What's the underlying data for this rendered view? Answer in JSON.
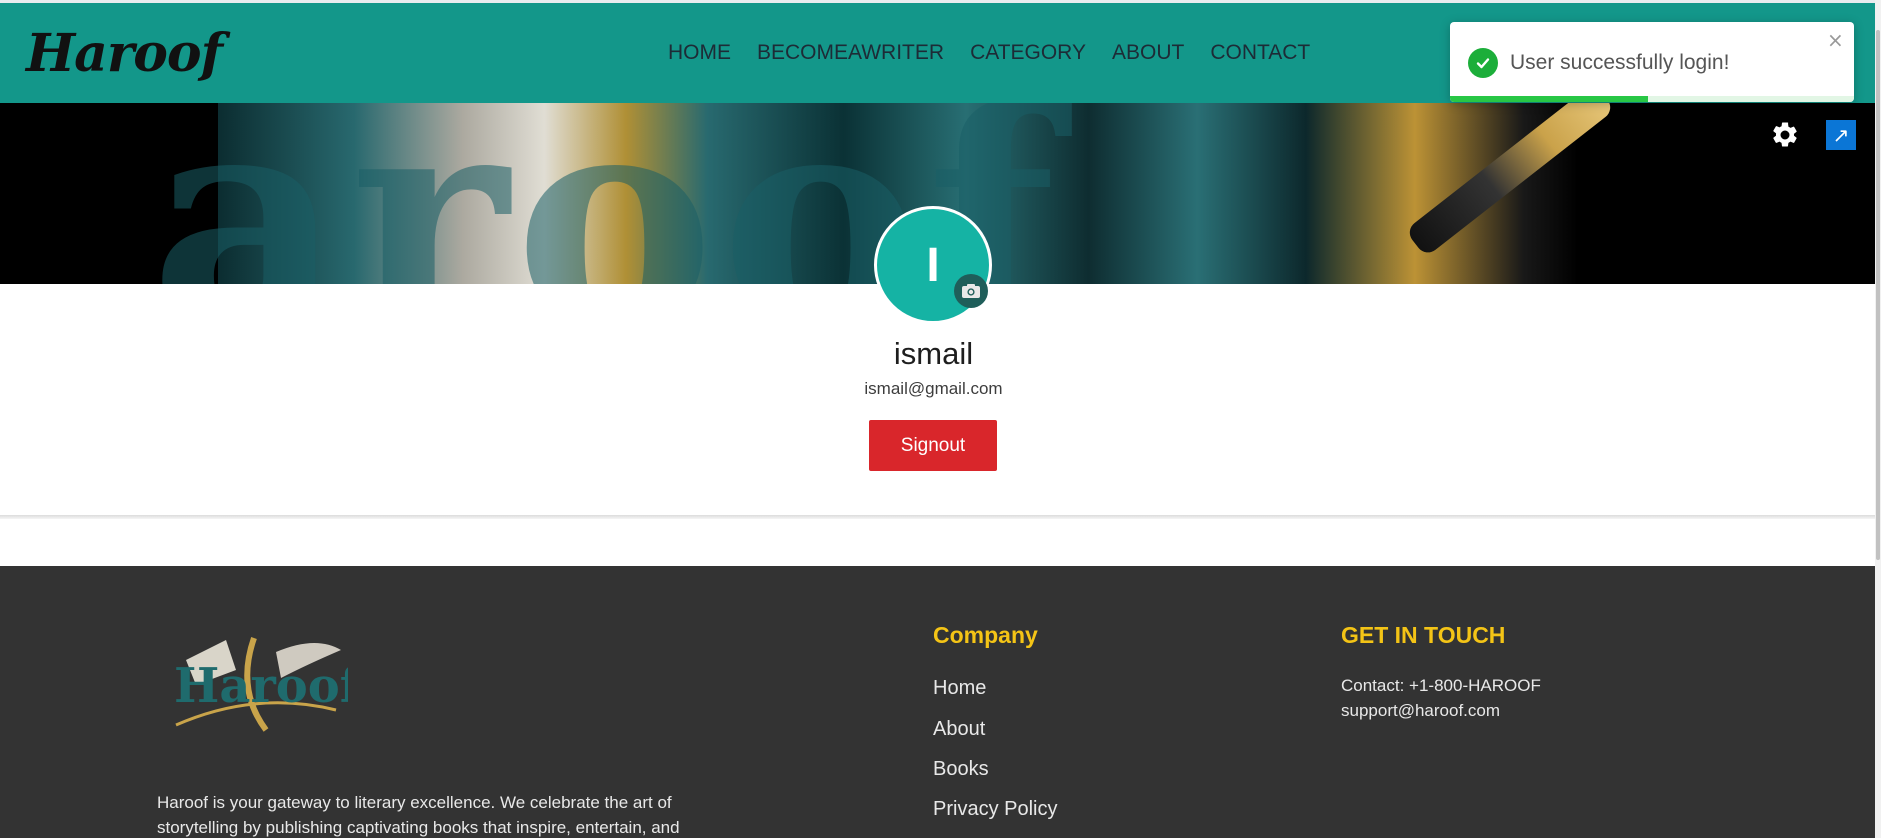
{
  "navbar": {
    "logo": "Haroof",
    "links": [
      "HOME",
      "BECOMEAWRITER",
      "CATEGORY",
      "ABOUT",
      "CONTACT"
    ],
    "background": "#13978a"
  },
  "hero": {
    "expand_glyph": "↗"
  },
  "profile": {
    "initial": "I",
    "name": "ismail",
    "email": "ismail@gmail.com",
    "signout_label": "Signout",
    "signout_color": "#d9262b"
  },
  "toast": {
    "message": "User successfully login!",
    "close_glyph": "×",
    "progress": 0.49
  },
  "footer": {
    "logo_text": "Haroof",
    "about": "Haroof is your gateway to literary excellence. We celebrate the art of storytelling by publishing captivating books that inspire, entertain, and",
    "company_heading": "Company",
    "company_links": [
      "Home",
      "About",
      "Books",
      "Privacy Policy"
    ],
    "contact_heading": "GET IN TOUCH",
    "contact_phone": "Contact: +1-800-HAROOF",
    "contact_email": "support@haroof.com",
    "heading_color": "#f4c416"
  }
}
